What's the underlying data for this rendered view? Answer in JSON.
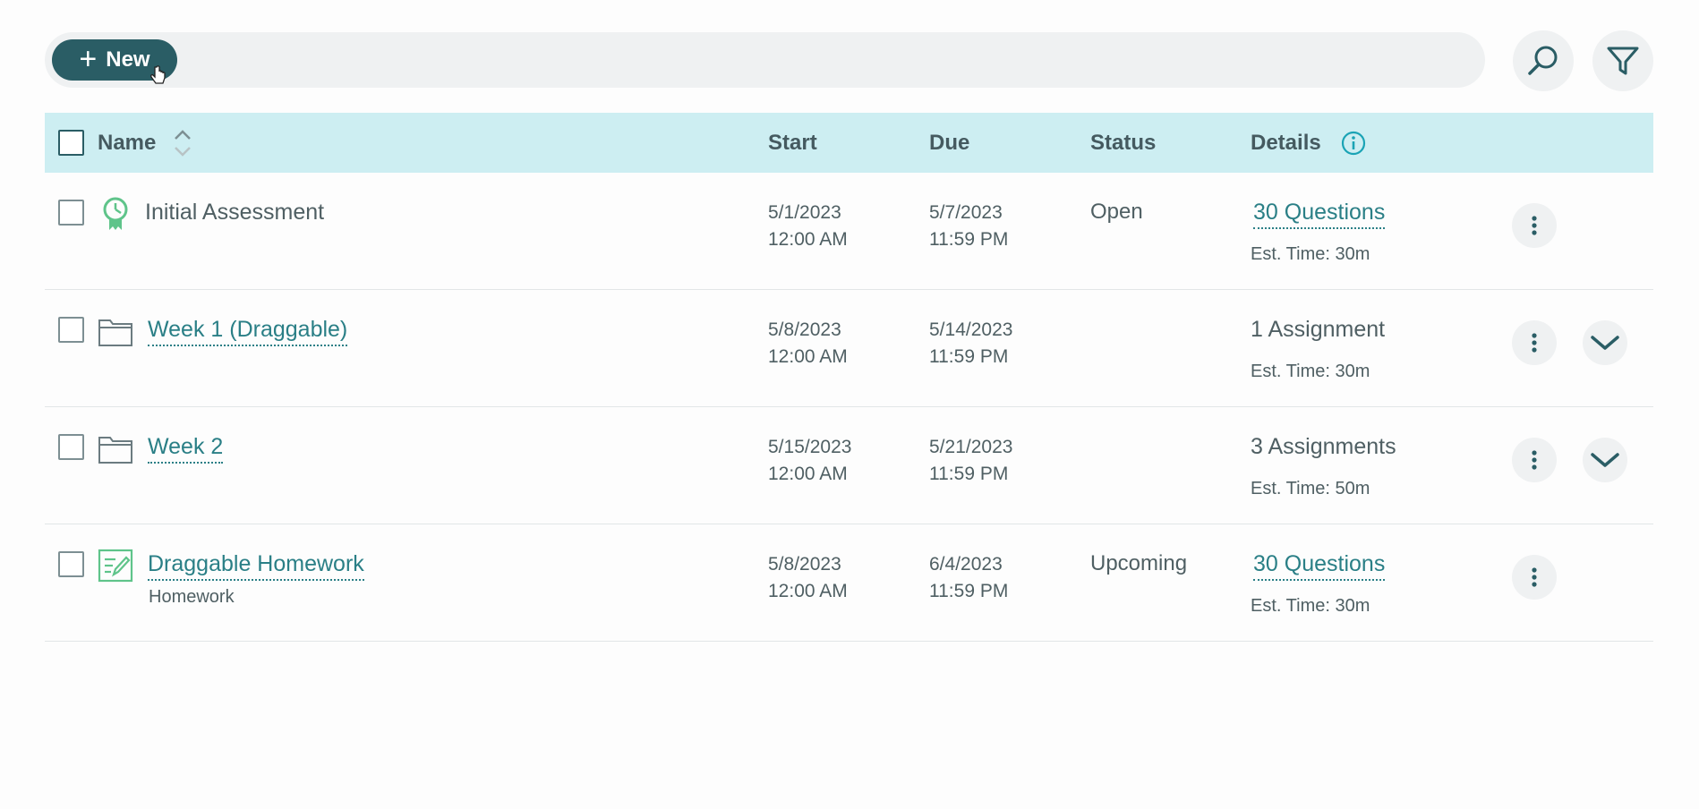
{
  "toolbar": {
    "new_label": "New"
  },
  "table": {
    "headers": {
      "name": "Name",
      "start": "Start",
      "due": "Due",
      "status": "Status",
      "details": "Details"
    },
    "rows": [
      {
        "type": "assessment",
        "name": "Initial Assessment",
        "start_date": "5/1/2023",
        "start_time": "12:00 AM",
        "due_date": "5/7/2023",
        "due_time": "11:59 PM",
        "status": "Open",
        "details": "30 Questions",
        "est": "Est. Time: 30m"
      },
      {
        "type": "folder",
        "name": "Week 1 (Draggable)",
        "start_date": "5/8/2023",
        "start_time": "12:00 AM",
        "due_date": "5/14/2023",
        "due_time": "11:59 PM",
        "status": "",
        "details": "1 Assignment",
        "est": "Est. Time: 30m"
      },
      {
        "type": "folder",
        "name": "Week 2",
        "start_date": "5/15/2023",
        "start_time": "12:00 AM",
        "due_date": "5/21/2023",
        "due_time": "11:59 PM",
        "status": "",
        "details": "3 Assignments",
        "est": "Est. Time: 50m"
      },
      {
        "type": "homework",
        "name": "Draggable Homework",
        "sublabel": "Homework",
        "start_date": "5/8/2023",
        "start_time": "12:00 AM",
        "due_date": "6/4/2023",
        "due_time": "11:59 PM",
        "status": "Upcoming",
        "details": "30 Questions",
        "est": "Est. Time: 30m"
      }
    ]
  },
  "colors": {
    "primary": "#2a5d65",
    "link": "#2a7f86",
    "header_bg": "#cdeef2",
    "icon_green": "#5fc48a"
  }
}
